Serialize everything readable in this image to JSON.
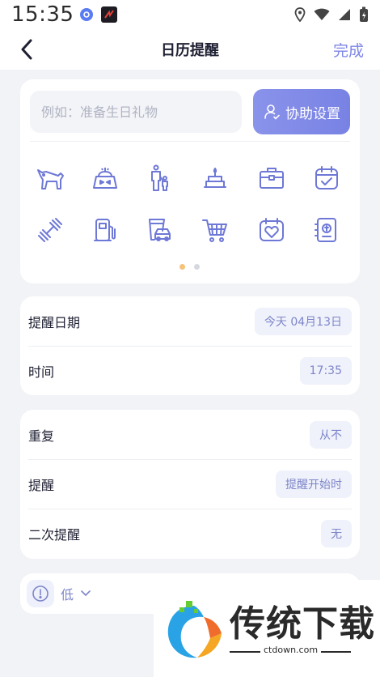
{
  "status": {
    "time": "15:35"
  },
  "header": {
    "title": "日历提醒",
    "done_label": "完成"
  },
  "event": {
    "title_placeholder": "例如：准备生日礼物",
    "title_value": "",
    "assist_label": "协助设置"
  },
  "icon_grid": {
    "rows": [
      [
        "dog-icon",
        "birthday-gift-icon",
        "family-icon",
        "cake-icon",
        "briefcase-icon",
        "calendar-check-icon"
      ],
      [
        "dumbbell-icon",
        "fuel-pump-icon",
        "car-wash-icon",
        "shopping-cart-icon",
        "anniversary-heart-icon",
        "passbook-icon"
      ]
    ],
    "page_count": 2,
    "active_page": 0,
    "accent_active": "#f5c27a",
    "accent_inactive": "#d6d8e0"
  },
  "schedule": {
    "date_label": "提醒日期",
    "date_value": "今天 04月13日",
    "time_label": "时间",
    "time_value": "17:35"
  },
  "options": {
    "repeat_label": "重复",
    "repeat_value": "从不",
    "reminder_label": "提醒",
    "reminder_value": "提醒开始时",
    "second_reminder_label": "二次提醒",
    "second_reminder_value": "无"
  },
  "priority": {
    "value": "低"
  },
  "watermark": {
    "brand": "传统下载",
    "url": "ctdown.com"
  },
  "colors": {
    "accent": "#7e86e6",
    "icon": "#6e78d6",
    "pill_bg": "#eff1fb"
  }
}
